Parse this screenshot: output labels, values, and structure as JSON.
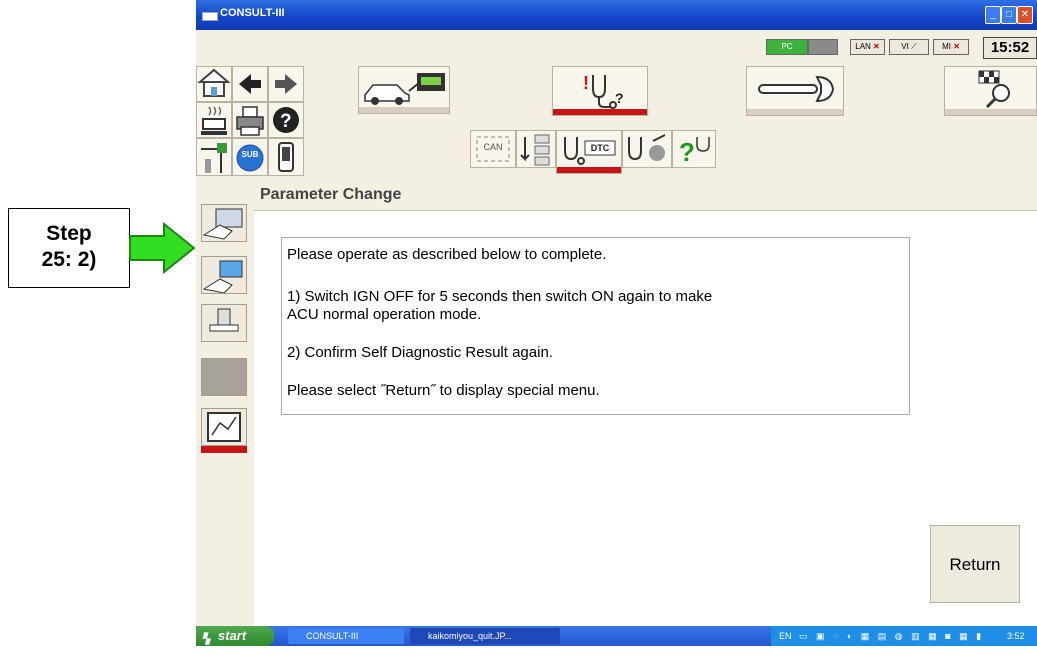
{
  "callout": {
    "line1": "Step",
    "line2": "25:  2)"
  },
  "window": {
    "title": "CONSULT-III",
    "controls": [
      "_",
      "□",
      "✕"
    ]
  },
  "status": {
    "pc_label": "PC",
    "lan_label": "LAN",
    "vi_label": "VI",
    "mi_label": "MI",
    "clock": "15:52"
  },
  "toolbar": {
    "can_label": "CAN",
    "dtc_label": "DTC",
    "sub_label": "SUB"
  },
  "page": {
    "title": "Parameter Change"
  },
  "message": {
    "line1": "Please operate as described below to complete.",
    "line2": "1) Switch IGN OFF for 5 seconds then switch ON again to make",
    "line3": "ACU normal operation mode.",
    "line4": "2) Confirm Self Diagnostic Result again.",
    "line5": "Please select ˝Return˝ to display special menu."
  },
  "buttons": {
    "return_label": "Return"
  },
  "taskbar": {
    "start_label": "start",
    "task1_label": "CONSULT-III",
    "task2_label": "kaikomiyou_quit.JP...",
    "tray_lang": "EN",
    "tray_time": "3:52 PM"
  },
  "colors": {
    "accent_red": "#c81414",
    "callout_arrow": "#33dd22",
    "title_blue": "#1343c8"
  }
}
